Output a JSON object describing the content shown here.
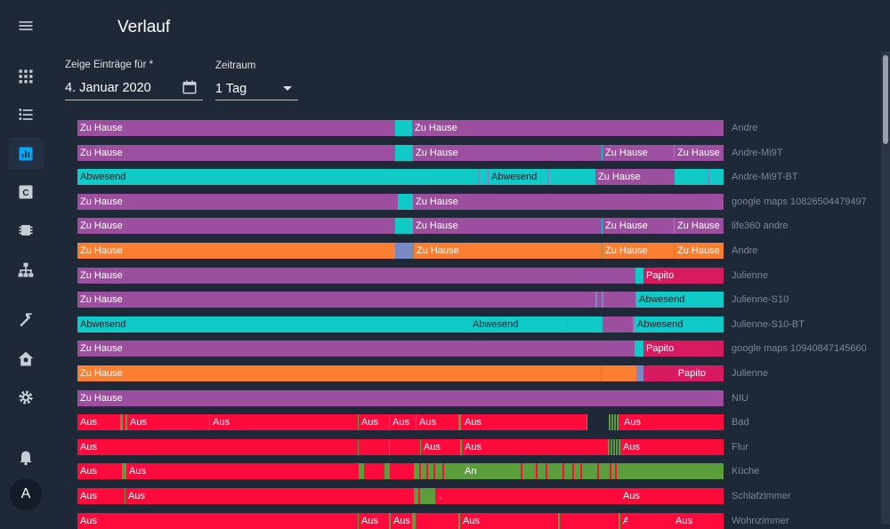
{
  "page": {
    "title": "Verlauf",
    "date_label": "Zeige Einträge für *",
    "date_value": "4. Januar 2020",
    "range_label": "Zeitraum",
    "range_value": "1 Tag"
  },
  "sidebar": {
    "avatar_letter": "A",
    "items": [
      {
        "name": "menu-icon"
      },
      {
        "name": "overview-icon"
      },
      {
        "name": "logbook-icon"
      },
      {
        "name": "history-icon",
        "active": true
      },
      {
        "name": "configurator-icon"
      },
      {
        "name": "integrations-icon"
      },
      {
        "name": "network-icon"
      },
      {
        "name": "developer-tools-icon"
      },
      {
        "name": "supervisor-icon"
      },
      {
        "name": "settings-icon"
      },
      {
        "name": "notifications-icon"
      }
    ]
  },
  "colors": {
    "Zu Hause": "#9c4f9e",
    "Abwesend": "#0fcac6",
    "Papito": "#d81b60",
    "orange": "#fb7f33",
    "blue": "#7a89c6",
    "Aus": "#ff0a3c",
    "An": "#5c9e3c",
    "olive": "#a6873a"
  },
  "rows": [
    {
      "name": "Andre",
      "segments": [
        {
          "s": 0,
          "e": 357,
          "c": "Zu Hause",
          "label": "Zu Hause"
        },
        {
          "s": 357,
          "e": 376,
          "c": "Abwesend"
        },
        {
          "s": 376,
          "e": 726,
          "c": "Zu Hause",
          "label": "Zu Hause"
        }
      ]
    },
    {
      "name": "Andre-Mi9T",
      "segments": [
        {
          "s": 0,
          "e": 357,
          "c": "Zu Hause",
          "label": "Zu Hause"
        },
        {
          "s": 357,
          "e": 377,
          "c": "Abwesend"
        },
        {
          "s": 377,
          "e": 589,
          "c": "Zu Hause",
          "label": "Zu Hause"
        },
        {
          "s": 589,
          "e": 590,
          "c": "Abwesend"
        },
        {
          "s": 590,
          "e": 670,
          "c": "Zu Hause",
          "label": "Zu Hause"
        },
        {
          "s": 670,
          "e": 671,
          "c": "Abwesend"
        },
        {
          "s": 671,
          "e": 726,
          "c": "Zu Hause",
          "label": "Zu Hause"
        }
      ]
    },
    {
      "name": "Andre-Mi9T-BT",
      "segments": [
        {
          "s": 0,
          "e": 450,
          "c": "Abwesend",
          "label": "Abwesend"
        },
        {
          "s": 450,
          "e": 452,
          "c": "blue"
        },
        {
          "s": 452,
          "e": 461,
          "c": "Abwesend"
        },
        {
          "s": 461,
          "e": 462,
          "c": "blue"
        },
        {
          "s": 462,
          "e": 528,
          "c": "Abwesend",
          "label": "Abwesend"
        },
        {
          "s": 528,
          "e": 530,
          "c": "blue"
        },
        {
          "s": 530,
          "e": 566,
          "c": "Abwesend"
        },
        {
          "s": 566,
          "e": 567,
          "c": "blue"
        },
        {
          "s": 567,
          "e": 582,
          "c": "Abwesend"
        },
        {
          "s": 582,
          "e": 671,
          "c": "Zu Hause",
          "label": "Zu Hause"
        },
        {
          "s": 671,
          "e": 708,
          "c": "Abwesend"
        },
        {
          "s": 708,
          "e": 711,
          "c": "blue"
        },
        {
          "s": 711,
          "e": 726,
          "c": "Abwesend"
        }
      ]
    },
    {
      "name": "google maps 10826504479497",
      "segments": [
        {
          "s": 0,
          "e": 360,
          "c": "Zu Hause",
          "label": "Zu Hause"
        },
        {
          "s": 360,
          "e": 377,
          "c": "Abwesend"
        },
        {
          "s": 377,
          "e": 726,
          "c": "Zu Hause",
          "label": "Zu Hause"
        }
      ]
    },
    {
      "name": "life360 andre",
      "segments": [
        {
          "s": 0,
          "e": 357,
          "c": "Zu Hause",
          "label": "Zu Hause"
        },
        {
          "s": 357,
          "e": 377,
          "c": "Abwesend"
        },
        {
          "s": 377,
          "e": 589,
          "c": "Zu Hause",
          "label": "Zu Hause"
        },
        {
          "s": 589,
          "e": 590,
          "c": "Abwesend"
        },
        {
          "s": 590,
          "e": 670,
          "c": "Zu Hause",
          "label": "Zu Hause"
        },
        {
          "s": 670,
          "e": 671,
          "c": "Abwesend"
        },
        {
          "s": 671,
          "e": 726,
          "c": "Zu Hause",
          "label": "Zu Hause"
        }
      ]
    },
    {
      "name": "Andre",
      "segments": [
        {
          "s": 0,
          "e": 357,
          "c": "orange",
          "label": "Zu Hause"
        },
        {
          "s": 357,
          "e": 376,
          "c": "blue"
        },
        {
          "s": 376,
          "e": 378,
          "c": "olive"
        },
        {
          "s": 378,
          "e": 589,
          "c": "orange",
          "label": "Zu Hause"
        },
        {
          "s": 589,
          "e": 590,
          "c": "olive"
        },
        {
          "s": 590,
          "e": 670,
          "c": "orange",
          "label": "Zu Hause"
        },
        {
          "s": 670,
          "e": 671,
          "c": "olive"
        },
        {
          "s": 671,
          "e": 726,
          "c": "orange",
          "label": "Zu Hause"
        }
      ]
    },
    {
      "name": "Julienne",
      "segments": [
        {
          "s": 0,
          "e": 627,
          "c": "Zu Hause",
          "label": "Zu Hause"
        },
        {
          "s": 627,
          "e": 636,
          "c": "Abwesend"
        },
        {
          "s": 636,
          "e": 726,
          "c": "Papito",
          "label": "Papito"
        }
      ]
    },
    {
      "name": "Julienne-S10",
      "segments": [
        {
          "s": 0,
          "e": 582,
          "c": "Zu Hause",
          "label": "Zu Hause"
        },
        {
          "s": 582,
          "e": 584,
          "c": "blue"
        },
        {
          "s": 584,
          "e": 589,
          "c": "Zu Hause"
        },
        {
          "s": 589,
          "e": 591,
          "c": "blue"
        },
        {
          "s": 591,
          "e": 627,
          "c": "Zu Hause"
        },
        {
          "s": 627,
          "e": 628,
          "c": "blue"
        },
        {
          "s": 628,
          "e": 726,
          "c": "Abwesend",
          "label": "Abwesend"
        }
      ]
    },
    {
      "name": "Julienne-S10-BT",
      "segments": [
        {
          "s": 0,
          "e": 440,
          "c": "Abwesend",
          "label": "Abwesend"
        },
        {
          "s": 440,
          "e": 441,
          "c": "blue"
        },
        {
          "s": 441,
          "e": 550,
          "c": "Abwesend",
          "label": "Abwesend"
        },
        {
          "s": 550,
          "e": 551,
          "c": "blue"
        },
        {
          "s": 551,
          "e": 590,
          "c": "Abwesend"
        },
        {
          "s": 590,
          "e": 624,
          "c": "Zu Hause"
        },
        {
          "s": 624,
          "e": 626,
          "c": "blue"
        },
        {
          "s": 626,
          "e": 726,
          "c": "Abwesend",
          "label": "Abwesend"
        }
      ]
    },
    {
      "name": "google maps 10940847145660",
      "segments": [
        {
          "s": 0,
          "e": 626,
          "c": "Zu Hause",
          "label": "Zu Hause"
        },
        {
          "s": 626,
          "e": 636,
          "c": "Abwesend"
        },
        {
          "s": 636,
          "e": 726,
          "c": "Papito",
          "label": "Papito"
        }
      ]
    },
    {
      "name": "Julienne",
      "segments": [
        {
          "s": 0,
          "e": 588,
          "c": "orange",
          "label": "Zu Hause"
        },
        {
          "s": 588,
          "e": 589,
          "c": "olive"
        },
        {
          "s": 589,
          "e": 628,
          "c": "orange"
        },
        {
          "s": 628,
          "e": 636,
          "c": "blue"
        },
        {
          "s": 636,
          "e": 726,
          "c": "Papito",
          "label": "Papito",
          "right": true
        }
      ]
    },
    {
      "name": "NIU",
      "segments": [
        {
          "s": 0,
          "e": 726,
          "c": "Zu Hause",
          "label": "Zu Hause"
        }
      ]
    },
    {
      "name": "Bad",
      "segments": [
        {
          "s": 0,
          "e": 48,
          "c": "Aus",
          "label": "Aus"
        },
        {
          "s": 48,
          "e": 51,
          "c": "An"
        },
        {
          "s": 51,
          "e": 54,
          "c": "Aus"
        },
        {
          "s": 54,
          "e": 56,
          "c": "An"
        },
        {
          "s": 56,
          "e": 148,
          "c": "Aus",
          "label": "Aus"
        },
        {
          "s": 148,
          "e": 149,
          "c": "An"
        },
        {
          "s": 149,
          "e": 315,
          "c": "Aus",
          "label": "Aus"
        },
        {
          "s": 315,
          "e": 316,
          "c": "An"
        },
        {
          "s": 316,
          "e": 350,
          "c": "Aus",
          "label": "Aus"
        },
        {
          "s": 350,
          "e": 351,
          "c": "An"
        },
        {
          "s": 351,
          "e": 380,
          "c": "Aus",
          "label": "Aus"
        },
        {
          "s": 380,
          "e": 381,
          "c": "An"
        },
        {
          "s": 381,
          "e": 428,
          "c": "Aus",
          "label": "Aus"
        },
        {
          "s": 428,
          "e": 431,
          "c": "An"
        },
        {
          "s": 431,
          "e": 432,
          "c": "Aus"
        },
        {
          "s": 432,
          "e": 572,
          "c": "Aus",
          "label": "Aus"
        },
        {
          "s": 572,
          "e": 573,
          "c": "An"
        },
        {
          "s": 597,
          "e": 599,
          "c": "An"
        },
        {
          "s": 600,
          "e": 602,
          "c": "An"
        },
        {
          "s": 603,
          "e": 605,
          "c": "An"
        },
        {
          "s": 606,
          "e": 608,
          "c": "An"
        },
        {
          "s": 608,
          "e": 611,
          "c": "Aus"
        },
        {
          "s": 611,
          "e": 726,
          "c": "Aus",
          "label": "Aus"
        }
      ]
    },
    {
      "name": "Flur",
      "segments": [
        {
          "s": 0,
          "e": 315,
          "c": "Aus",
          "label": "Aus"
        },
        {
          "s": 315,
          "e": 316,
          "c": "An"
        },
        {
          "s": 316,
          "e": 350,
          "c": "Aus"
        },
        {
          "s": 350,
          "e": 351,
          "c": "An"
        },
        {
          "s": 351,
          "e": 385,
          "c": "Aus"
        },
        {
          "s": 385,
          "e": 386,
          "c": "An"
        },
        {
          "s": 386,
          "e": 430,
          "c": "Aus",
          "label": "Aus"
        },
        {
          "s": 430,
          "e": 432,
          "c": "An"
        },
        {
          "s": 432,
          "e": 596,
          "c": "Aus",
          "label": "Aus"
        },
        {
          "s": 596,
          "e": 598,
          "c": "An"
        },
        {
          "s": 599,
          "e": 601,
          "c": "An"
        },
        {
          "s": 602,
          "e": 604,
          "c": "An"
        },
        {
          "s": 605,
          "e": 607,
          "c": "An"
        },
        {
          "s": 608,
          "e": 610,
          "c": "An"
        },
        {
          "s": 610,
          "e": 726,
          "c": "Aus",
          "label": "Aus"
        }
      ]
    },
    {
      "name": "Küche",
      "segments": [
        {
          "s": 0,
          "e": 50,
          "c": "Aus",
          "label": "Aus"
        },
        {
          "s": 50,
          "e": 55,
          "c": "An"
        },
        {
          "s": 55,
          "e": 316,
          "c": "Aus",
          "label": "Aus"
        },
        {
          "s": 316,
          "e": 322,
          "c": "An"
        },
        {
          "s": 322,
          "e": 345,
          "c": "Aus"
        },
        {
          "s": 345,
          "e": 351,
          "c": "An"
        },
        {
          "s": 351,
          "e": 378,
          "c": "Aus"
        },
        {
          "s": 378,
          "e": 432,
          "c": "An"
        },
        {
          "s": 384,
          "e": 386,
          "c": "Aus"
        },
        {
          "s": 392,
          "e": 394,
          "c": "Aus"
        },
        {
          "s": 400,
          "e": 402,
          "c": "Aus"
        },
        {
          "s": 410,
          "e": 412,
          "c": "Aus"
        },
        {
          "s": 432,
          "e": 726,
          "c": "An",
          "label": "An"
        },
        {
          "s": 498,
          "e": 500,
          "c": "Aus"
        },
        {
          "s": 515,
          "e": 517,
          "c": "Aus"
        },
        {
          "s": 526,
          "e": 528,
          "c": "Aus"
        },
        {
          "s": 545,
          "e": 547,
          "c": "Aus"
        },
        {
          "s": 556,
          "e": 558,
          "c": "Aus"
        },
        {
          "s": 565,
          "e": 567,
          "c": "Aus"
        },
        {
          "s": 584,
          "e": 586,
          "c": "Aus"
        },
        {
          "s": 598,
          "e": 600,
          "c": "Aus"
        },
        {
          "s": 604,
          "e": 606,
          "c": "Aus"
        }
      ]
    },
    {
      "name": "Schlafzimmer",
      "segments": [
        {
          "s": 0,
          "e": 53,
          "c": "Aus",
          "label": "Aus"
        },
        {
          "s": 53,
          "e": 54,
          "c": "An"
        },
        {
          "s": 54,
          "e": 378,
          "c": "Aus",
          "label": "Aus"
        },
        {
          "s": 378,
          "e": 383,
          "c": "An"
        },
        {
          "s": 383,
          "e": 385,
          "c": "Aus"
        },
        {
          "s": 385,
          "e": 402,
          "c": "An"
        },
        {
          "s": 402,
          "e": 404,
          "c": "Aus"
        },
        {
          "s": 404,
          "e": 408,
          "c": "Aus",
          "label": "Aus"
        },
        {
          "s": 408,
          "e": 610,
          "c": "Aus"
        },
        {
          "s": 610,
          "e": 726,
          "c": "Aus",
          "label": "Aus"
        }
      ]
    },
    {
      "name": "Wohnzimmer",
      "segments": [
        {
          "s": 0,
          "e": 315,
          "c": "Aus",
          "label": "Aus"
        },
        {
          "s": 315,
          "e": 316,
          "c": "An"
        },
        {
          "s": 316,
          "e": 350,
          "c": "Aus",
          "label": "Aus"
        },
        {
          "s": 350,
          "e": 352,
          "c": "An"
        },
        {
          "s": 352,
          "e": 376,
          "c": "Aus",
          "label": "Aus"
        },
        {
          "s": 376,
          "e": 380,
          "c": "An"
        },
        {
          "s": 380,
          "e": 428,
          "c": "Aus"
        },
        {
          "s": 428,
          "e": 430,
          "c": "An"
        },
        {
          "s": 430,
          "e": 540,
          "c": "Aus",
          "label": "Aus"
        },
        {
          "s": 540,
          "e": 542,
          "c": "An"
        },
        {
          "s": 542,
          "e": 543,
          "c": "Aus",
          "label": "Aus"
        },
        {
          "s": 543,
          "e": 608,
          "c": "Aus"
        },
        {
          "s": 608,
          "e": 610,
          "c": "An"
        },
        {
          "s": 610,
          "e": 618,
          "c": "Aus",
          "label": "Aus"
        },
        {
          "s": 618,
          "e": 669,
          "c": "Aus"
        },
        {
          "s": 669,
          "e": 726,
          "c": "Aus",
          "label": "Aus"
        }
      ]
    }
  ]
}
